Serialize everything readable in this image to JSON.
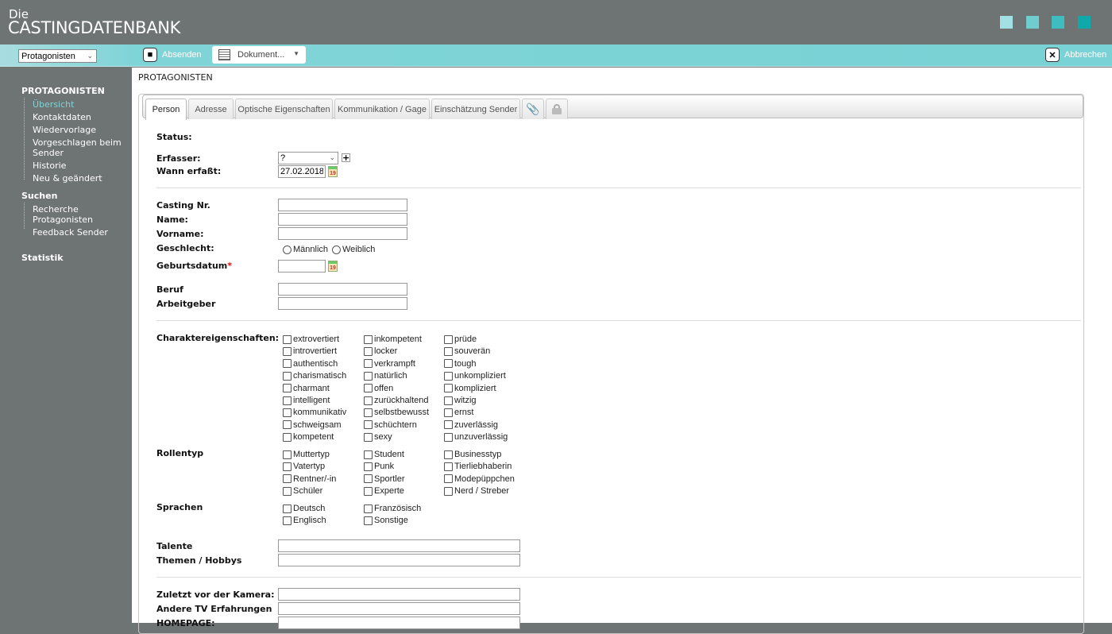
{
  "header": {
    "logo_small": "Die",
    "logo_big": "CASTINGDATENBANK",
    "color_squares": [
      "#a3e0e3",
      "#6fcdd0",
      "#3ebcbf",
      "#0fa9a9"
    ]
  },
  "toolbar": {
    "module_select": "Protagonisten",
    "submit_label": "Absenden",
    "document_label": "Dokument...",
    "cancel_label": "Abbrechen"
  },
  "sidebar": {
    "section1": "PROTAGONISTEN",
    "items1": [
      "Übersicht",
      "Kontaktdaten",
      "Wiedervorlage",
      "Vorgeschlagen beim Sender",
      "Historie",
      "Neu & geändert"
    ],
    "section2": "Suchen",
    "items2": [
      "Recherche Protagonisten",
      "Feedback Sender"
    ],
    "section3": "Statistik"
  },
  "main": {
    "title": "PROTAGONISTEN",
    "tabs": [
      "Person",
      "Adresse",
      "Optische Eigenschaften",
      "Kommunikation / Gage",
      "Einschätzung Sender"
    ],
    "form": {
      "status_label": "Status:",
      "erfasser_label": "Erfasser:",
      "erfasser_value": "?",
      "wann_label": "Wann erfaßt:",
      "wann_value": "27.02.2018",
      "casting_label": "Casting Nr.",
      "name_label": "Name:",
      "vorname_label": "Vorname:",
      "geschlecht_label": "Geschlecht:",
      "geschlecht_options": [
        "Männlich",
        "Weiblich"
      ],
      "geburtsdatum_label": "Geburtsdatum",
      "required_mark": "*",
      "beruf_label": "Beruf",
      "arbeitgeber_label": "Arbeitgeber",
      "charakter_label": "Charaktereigenschaften:",
      "charakter": [
        [
          "extrovertiert",
          "introvertiert",
          "authentisch",
          "charismatisch",
          "charmant",
          "intelligent",
          "kommunikativ",
          "schweigsam",
          "kompetent"
        ],
        [
          "inkompetent",
          "locker",
          "verkrampft",
          "natürlich",
          "offen",
          "zurückhaltend",
          "selbstbewusst",
          "schüchtern",
          "sexy"
        ],
        [
          "prüde",
          "souverän",
          "tough",
          "unkompliziert",
          "kompliziert",
          "witzig",
          "ernst",
          "zuverlässig",
          "unzuverlässig"
        ]
      ],
      "rollentyp_label": "Rollentyp",
      "rollentyp": [
        [
          "Muttertyp",
          "Vatertyp",
          "Rentner/-in",
          "Schüler"
        ],
        [
          "Student",
          "Punk",
          "Sportler",
          "Experte"
        ],
        [
          "Businesstyp",
          "Tierliebhaberin",
          "Modepüppchen",
          "Nerd / Streber"
        ]
      ],
      "sprachen_label": "Sprachen",
      "sprachen": [
        [
          "Deutsch",
          "Englisch"
        ],
        [
          "Französisch",
          "Sonstige"
        ]
      ],
      "talente_label": "Talente",
      "themen_label": "Themen / Hobbys",
      "zuletzt_label": "Zuletzt vor der Kamera:",
      "andere_label": "Andere TV Erfahrungen",
      "homepage_label": "HOMEPAGE:"
    }
  }
}
